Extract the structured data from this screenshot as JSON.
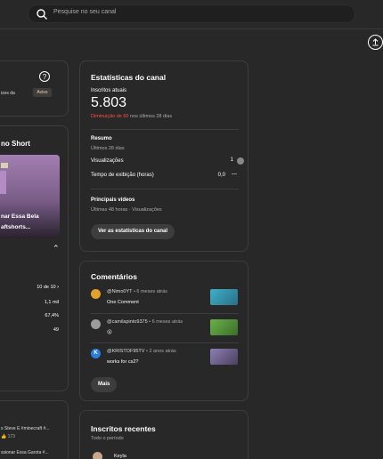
{
  "search": {
    "placeholder": "Pesquise no seu canal"
  },
  "left": {
    "card1_text": "izes da",
    "aviso_label": "Aviso",
    "short_title": "no Short",
    "short_caption_1": "nar Essa Bela",
    "short_caption_2": "aftshorts...",
    "rows": [
      {
        "value": "10 de 10"
      },
      {
        "value": "1,1 mil"
      },
      {
        "value": "67,4%"
      },
      {
        "value": "49"
      }
    ],
    "bottom_items": [
      {
        "title": "s Steve E #minecraft #...",
        "likes": "173"
      },
      {
        "title": "ssionar Essa Garota #..."
      }
    ]
  },
  "stats": {
    "title": "Estatísticas do canal",
    "subs_label": "Inscritos atuais",
    "subs_value": "5.803",
    "delta_red": "Diminuição de 60",
    "delta_rest": " nos últimos 28 dias",
    "summary_title": "Resumo",
    "summary_period": "Últimos 28 dias",
    "views_label": "Visualizações",
    "views_value": "1",
    "watch_label": "Tempo de exibição (horas)",
    "watch_value": "0,0",
    "watch_trend": "—",
    "top_title": "Principais vídeos",
    "top_sub": "Últimas 48 horas · Visualizações",
    "button": "Ver as estatísticas do canal"
  },
  "comments": {
    "title": "Comentários",
    "items": [
      {
        "author": "@Nimo0YT",
        "time": "• 6 meses atrás",
        "text": "One Comment",
        "avatar_color": "#e2a12c"
      },
      {
        "author": "@camilapinto9375",
        "time": "• 6 meses atrás",
        "text": "😮",
        "avatar_color": "#9b9b9b"
      },
      {
        "author": "@KRISTOF95TV",
        "time": "• 2 anos atrás",
        "text": "works for cs2?",
        "avatar_color": "#2b7de0"
      }
    ],
    "more_button": "Mais",
    "avatar_letter_3": "K"
  },
  "recent": {
    "title": "Inscritos recentes",
    "period": "Todo o período",
    "first_name": "Keyla"
  }
}
